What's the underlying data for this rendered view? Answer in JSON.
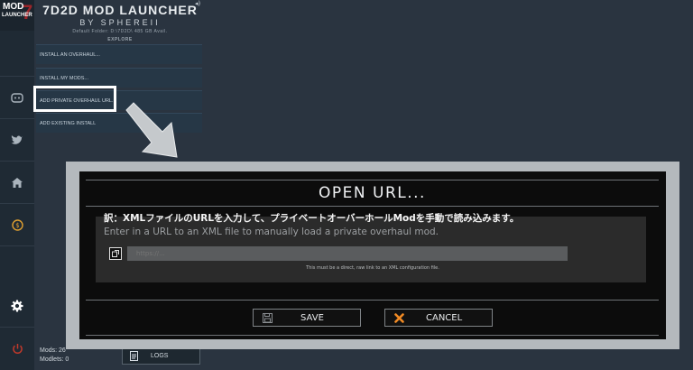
{
  "app": {
    "title": "7D2D MOD LAUNCHER",
    "byline": "BY SPHEREII",
    "default_folder": "Default Folder: D:\\7D2D\\ 485 GB Avail.",
    "explore_label": "EXPLORE",
    "logo_line1": "MOD",
    "logo_line2": "LAUNCHER",
    "logo_mark": "7"
  },
  "menu": {
    "items": [
      {
        "label": "INSTALL AN OVERHAUL..."
      },
      {
        "label": "INSTALL MY MODS..."
      },
      {
        "label": "ADD PRIVATE OVERHAUL URL..."
      },
      {
        "label": "ADD EXISTING INSTALL"
      }
    ]
  },
  "sidebar": {
    "icons": [
      "discord-icon",
      "twitter-icon",
      "home-icon",
      "donate-icon",
      "gear-icon",
      "power-icon"
    ]
  },
  "status": {
    "mods": "Mods: 26",
    "modlets": "Modlets: 0"
  },
  "logs_label": "LOGS",
  "dialog": {
    "title": "OPEN URL...",
    "translation": "訳：XMLファイルのURLを入力して、プライベートオーバーホールModを手動で読み込みます。",
    "instruction": "Enter in a URL to an XML file to manually load a private overhaul mod.",
    "url_placeholder": "https://...",
    "hint": "This must be a direct, raw link to an XML configuration file.",
    "save_label": "SAVE",
    "cancel_label": "CANCEL"
  },
  "colors": {
    "accent_red": "#b3262a",
    "cancel_x": "#f08a24"
  }
}
